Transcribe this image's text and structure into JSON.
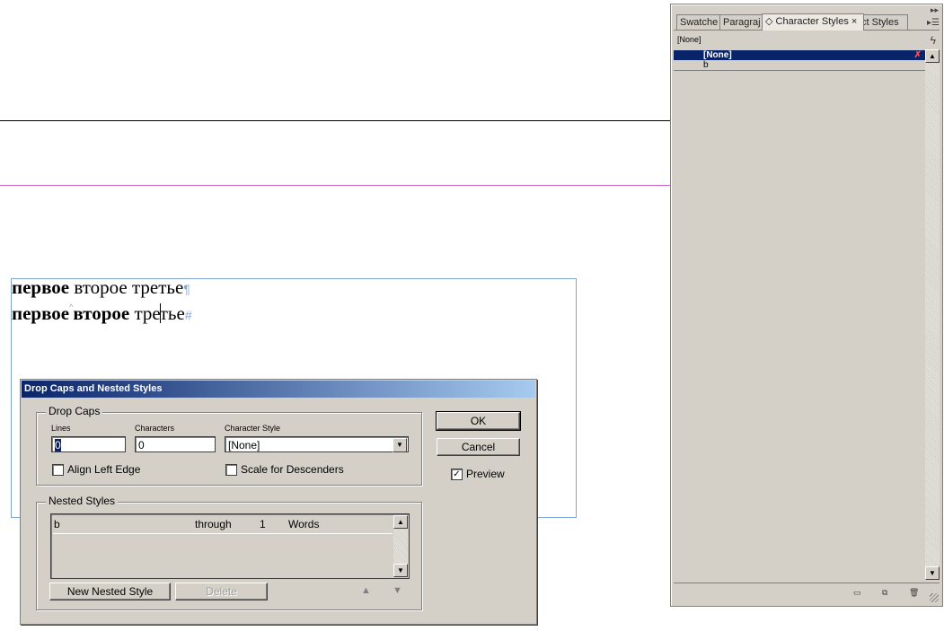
{
  "document": {
    "line1": {
      "bold": "первое",
      "rest": " второе третье",
      "mark": "¶"
    },
    "line2": {
      "bold1": "первое",
      "sep": "^",
      "bold2": "второе",
      "rest_before_caret": " тре",
      "rest_after_caret": "тье",
      "mark": "#"
    }
  },
  "dialog": {
    "title": "Drop Caps and Nested Styles",
    "drop_caps": {
      "group_label": "Drop Caps",
      "lines_label": "Lines",
      "lines_value": "0",
      "characters_label": "Characters",
      "characters_value": "0",
      "char_style_label": "Character Style",
      "char_style_value": "[None]",
      "align_left_edge_label": "Align Left Edge",
      "align_left_edge_checked": false,
      "scale_descenders_label": "Scale for Descenders",
      "scale_descenders_checked": false
    },
    "nested_styles": {
      "group_label": "Nested Styles",
      "rows": [
        {
          "style": "b",
          "mode": "through",
          "count": "1",
          "unit": "Words"
        }
      ],
      "new_button": "New Nested Style",
      "delete_button": "Delete"
    },
    "ok_button": "OK",
    "cancel_button": "Cancel",
    "preview_label": "Preview",
    "preview_checked": true
  },
  "panel": {
    "tabs": [
      "Swatche",
      "Paragraj",
      "◇ Character Styles ×",
      "ct Styles"
    ],
    "current_style": "[None]",
    "styles": [
      {
        "name": "[None]",
        "selected": true
      },
      {
        "name": "b",
        "selected": false
      }
    ]
  }
}
